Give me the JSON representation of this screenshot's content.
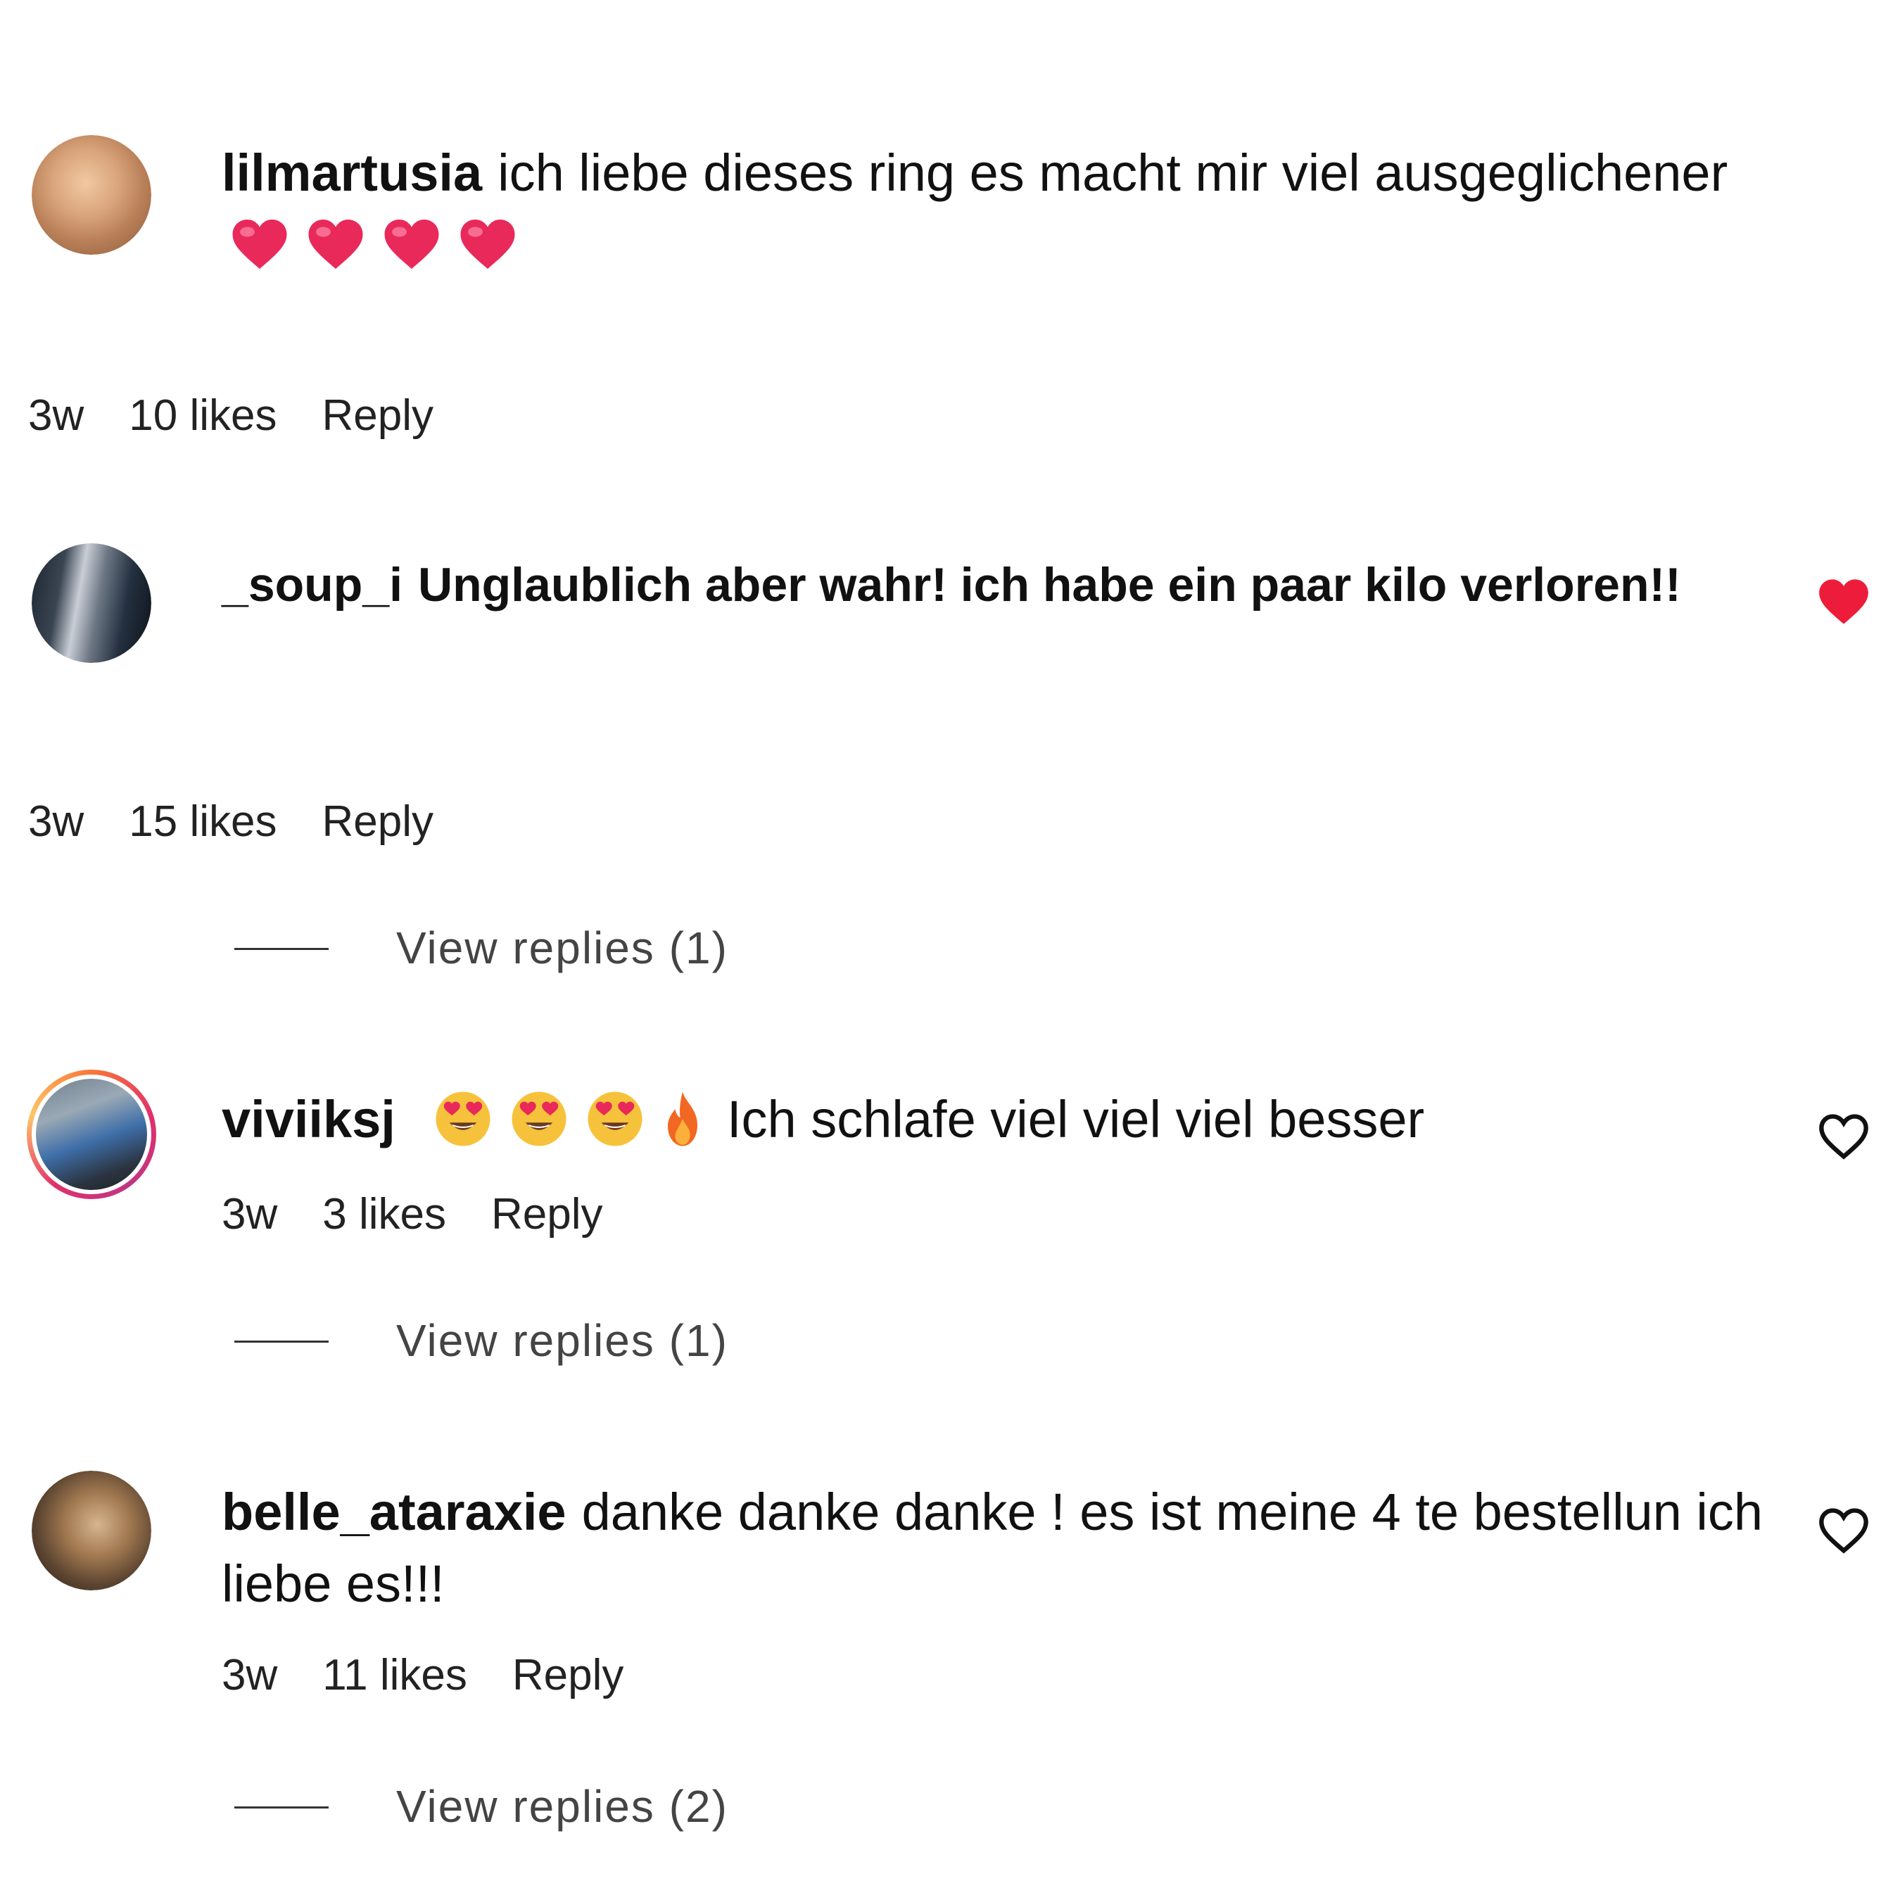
{
  "comments": [
    {
      "username": "lilmartusia",
      "text_a": "ich liebe dieses ring es macht mir viel ausgeglichener",
      "emojis_after": [
        "heart-emoji",
        "heart-emoji",
        "heart-emoji",
        "heart-emoji"
      ],
      "time": "3w",
      "likes": "10 likes",
      "reply": "Reply",
      "liked": false
    },
    {
      "username": "_soup_i",
      "text_a": "Unglaublich aber wahr! ich habe ein paar kilo verloren!!",
      "time": "3w",
      "likes": "15 likes",
      "reply": "Reply",
      "liked": true,
      "view_replies": "View replies (1)"
    },
    {
      "username": "viviiksj",
      "emojis_before": [
        "heart-eyes-emoji",
        "heart-eyes-emoji",
        "heart-eyes-emoji",
        "fire-emoji"
      ],
      "text_a": "Ich schlafe viel viel viel besser",
      "time": "3w",
      "likes": "3 likes",
      "reply": "Reply",
      "liked": false,
      "has_story_ring": true,
      "view_replies": "View replies (1)"
    },
    {
      "username": "belle_ataraxie",
      "text_a": "danke danke danke ! es ist meine 4 te bestellun ich liebe es!!!",
      "time": "3w",
      "likes": "11 likes",
      "reply": "Reply",
      "liked": false,
      "view_replies": "View replies (2)"
    }
  ],
  "colors": {
    "liked_heart": "#ed1c3a",
    "emoji_heart": "#e8295a",
    "story_ring": [
      "#f77737",
      "#e1306c",
      "#c13584",
      "#fdc468"
    ]
  }
}
